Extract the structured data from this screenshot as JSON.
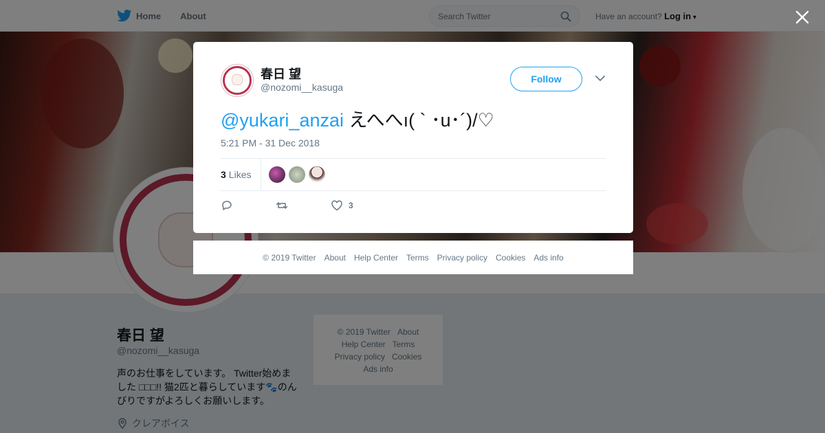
{
  "topbar": {
    "home_label": "Home",
    "about_label": "About",
    "search_placeholder": "Search Twitter",
    "account_prompt": "Have an account?",
    "login_label": "Log in"
  },
  "profile": {
    "name": "春日 望",
    "handle": "@nozomi__kasuga",
    "bio": "声のお仕事をしています。 Twitter始めました □□□!! 猫2匹と暮らしています🐾のんびりですがよろしくお願いします。",
    "location": "クレアボイス"
  },
  "bg_footer": {
    "links": [
      "© 2019 Twitter",
      "About",
      "Help Center",
      "Terms",
      "Privacy policy",
      "Cookies",
      "Ads info"
    ]
  },
  "tweet": {
    "author_name": "春日 望",
    "author_handle": "@nozomi__kasuga",
    "follow_label": "Follow",
    "mention": "@yukari_anzai",
    "text": " えへへı( ` ･u･´)/♡",
    "timestamp": "5:21 PM - 31 Dec 2018",
    "likes_count": "3",
    "likes_label": "Likes",
    "action_like_count": "3",
    "liker_colors": [
      "#3a2a4a",
      "#8fa08a",
      "#e8d6d2"
    ]
  },
  "modal_footer": {
    "links": [
      "© 2019 Twitter",
      "About",
      "Help Center",
      "Terms",
      "Privacy policy",
      "Cookies",
      "Ads info"
    ]
  },
  "colors": {
    "accent": "#1da1f2",
    "avatar_ring": "#b8324f"
  }
}
